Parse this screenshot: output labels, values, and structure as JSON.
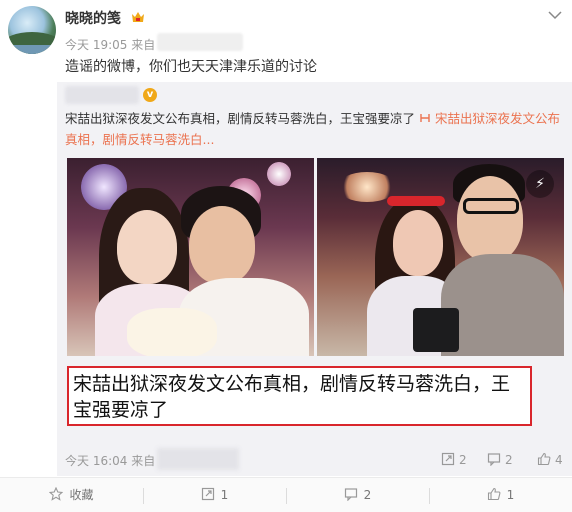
{
  "post": {
    "username": "晓晓的笺",
    "time": "今天 19:05 来自",
    "text": "造谣的微博，你们也天天津津乐道的讨论"
  },
  "repost": {
    "text_main": "宋喆出狱深夜发文公布真相，剧情反转马蓉洗白，王宝强要凉了",
    "link_text": "宋喆出狱深夜发文公布真相，剧情反转马蓉洗白...",
    "headline": "宋喆出狱深夜发文公布真相，剧情反转马蓉洗白，王宝强要凉了",
    "time": "今天 16:04 来自",
    "reposts": "2",
    "comments": "2",
    "likes": "4"
  },
  "actions": {
    "favorite_label": "收藏",
    "repost_count": "1",
    "comment_count": "2",
    "like_count": "1"
  },
  "colors": {
    "accent_link": "#eb7350",
    "highlight_border": "#d9262c",
    "vip_badge": "#f0a818"
  }
}
